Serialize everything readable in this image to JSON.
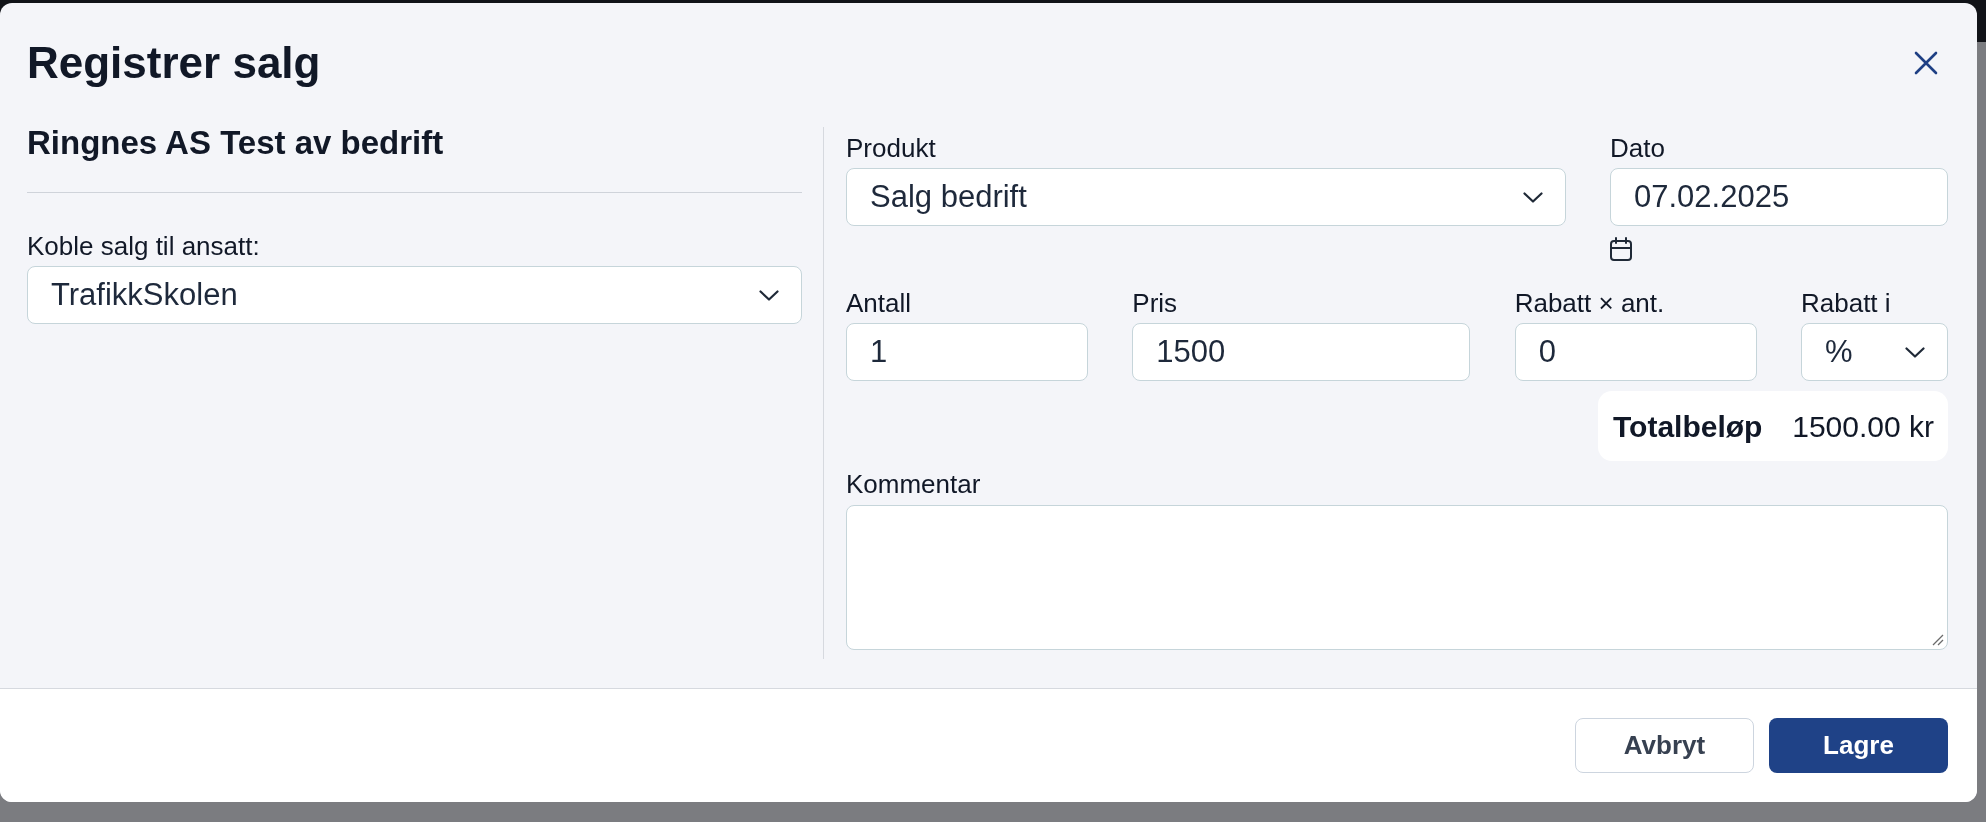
{
  "dialog": {
    "title": "Registrer salg"
  },
  "customer": {
    "name": "Ringnes AS Test av bedrift"
  },
  "employee_select": {
    "label": "Koble salg til ansatt:",
    "value": "TrafikkSkolen"
  },
  "rows": [
    {
      "fields": [
        {
          "kind": "select",
          "label": "Produkt",
          "value": "Salg bedrift"
        },
        {
          "kind": "date",
          "label": "Dato",
          "value": "07.02.2025"
        }
      ]
    },
    {
      "fields": [
        {
          "kind": "input",
          "label": "Antall",
          "value": "1"
        },
        {
          "kind": "input",
          "label": "Pris",
          "value": "1500"
        },
        {
          "kind": "input",
          "label": "Rabatt × ant.",
          "value": "0"
        },
        {
          "kind": "select",
          "label": "Rabatt i",
          "value": "%"
        }
      ]
    }
  ],
  "total": {
    "label": "Totalbeløp",
    "value": "1500.00 kr"
  },
  "comment": {
    "label": "Kommentar"
  },
  "buttons": [
    {
      "kind": "secondary",
      "label": "Avbryt"
    },
    {
      "kind": "primary",
      "label": "Lagre"
    }
  ]
}
